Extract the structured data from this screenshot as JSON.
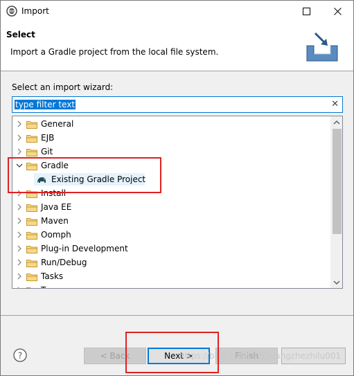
{
  "window": {
    "title": "Import"
  },
  "header": {
    "title": "Select",
    "description": "Import a Gradle project from the local file system."
  },
  "wizard": {
    "label": "Select an import wizard:",
    "filter_value": "type filter text"
  },
  "tree": {
    "items": [
      {
        "label": "General",
        "expanded": false
      },
      {
        "label": "EJB",
        "expanded": false
      },
      {
        "label": "Git",
        "expanded": false
      },
      {
        "label": "Gradle",
        "expanded": true
      },
      {
        "label": "Existing Gradle Project",
        "child": true,
        "selected": true
      },
      {
        "label": "Install",
        "expanded": false
      },
      {
        "label": "Java EE",
        "expanded": false
      },
      {
        "label": "Maven",
        "expanded": false
      },
      {
        "label": "Oomph",
        "expanded": false
      },
      {
        "label": "Plug-in Development",
        "expanded": false
      },
      {
        "label": "Run/Debug",
        "expanded": false
      },
      {
        "label": "Tasks",
        "expanded": false
      },
      {
        "label": "T",
        "expanded": false
      }
    ]
  },
  "buttons": {
    "back": "< Back",
    "next": "Next >",
    "finish": "Finish"
  },
  "watermark": "https://blog.csdn.net/wangzhezhilu001",
  "colors": {
    "accent": "#0078d7",
    "highlight": "#e02020",
    "folder": "#dcb14b"
  }
}
